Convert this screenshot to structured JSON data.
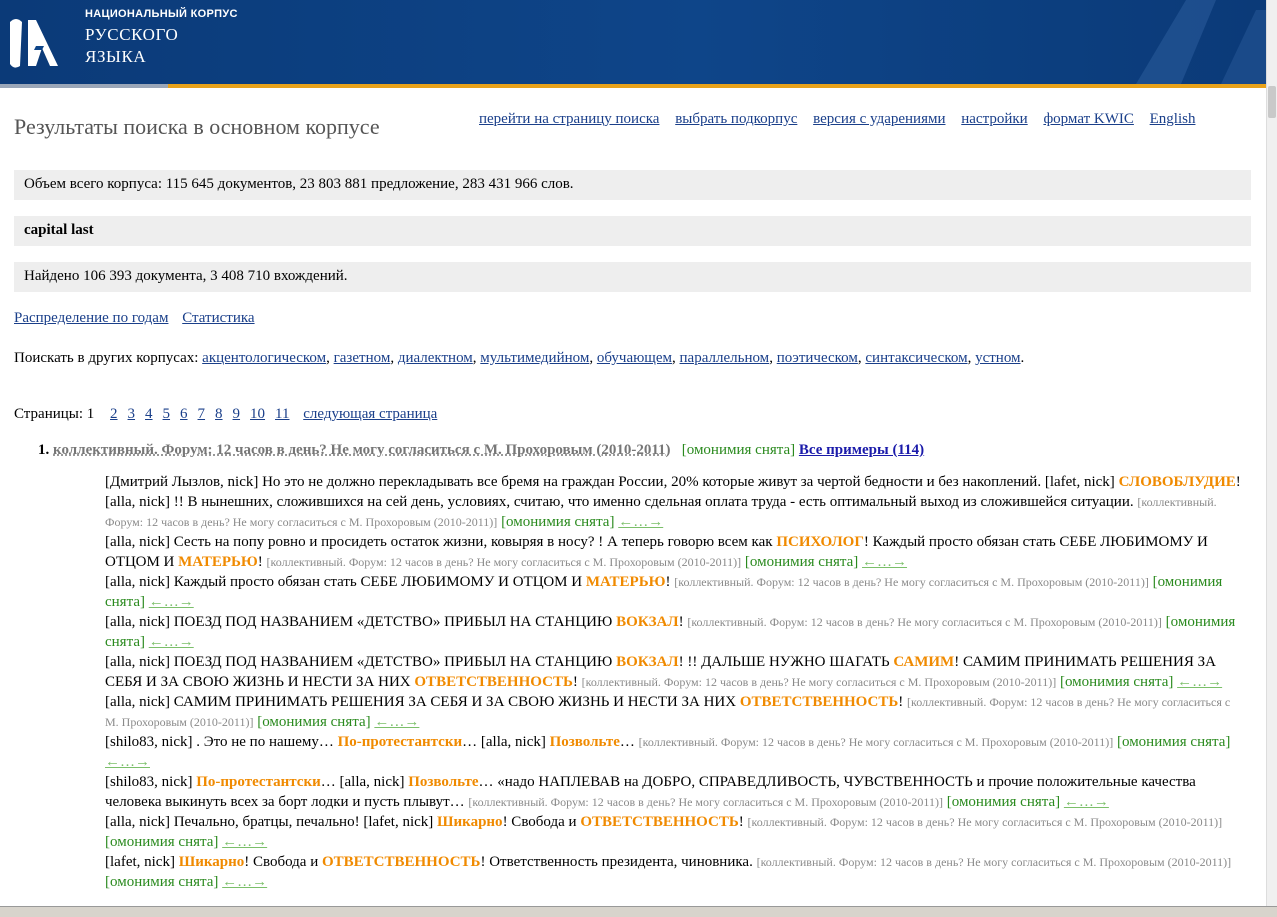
{
  "logo": {
    "line1": "НАЦИОНАЛЬНЫЙ КОРПУС",
    "line2": "РУССКОГО",
    "line3": "ЯЗЫКА"
  },
  "page_title": "Результаты поиска в основном корпусе",
  "top_links": [
    "перейти на страницу поиска",
    "выбрать подкорпус",
    "версия с ударениями",
    "настройки",
    "формат KWIC",
    "English"
  ],
  "corpus_size": "Объем всего корпуса: 115 645 документов, 23 803 881 предложение, 283 431 966 слов.",
  "query": "capital last",
  "found": "Найдено 106 393 документа, 3 408 710 вхождений.",
  "stat_links": [
    "Распределение по годам",
    "Статистика"
  ],
  "other_corpora": {
    "prefix": "Поискать в других корпусах:",
    "items": [
      "акцентологическом",
      "газетном",
      "диалектном",
      "мультимедийном",
      "обучающем",
      "параллельном",
      "поэтическом",
      "синтаксическом",
      "устном"
    ]
  },
  "pages": {
    "label": "Страницы:",
    "current": "1",
    "items": [
      "2",
      "3",
      "4",
      "5",
      "6",
      "7",
      "8",
      "9",
      "10",
      "11"
    ],
    "next": "следующая страница"
  },
  "result": {
    "number": "1.",
    "title": "коллективный. Форум: 12 часов в день? Не могу согласиться с М. Прохоровым (2010-2011)",
    "homonymy": "[омонимия снята]",
    "all_examples": "Все примеры (114)",
    "source": "[коллективный. Форум: 12 часов в день? Не могу согласиться с М. Прохоровым (2010-2011)]",
    "arrows": "←…→",
    "snippets": [
      [
        {
          "t": "[Дмитрий Лызлов, nick] Но это не должно перекладывать все бремя на граждан России, 20% которые живут за чертой бедности и без накоплений. [lafet, nick] "
        },
        {
          "h": "СЛОВОБЛУДИЕ"
        },
        {
          "t": "! [alla, nick] !! В нынешних, сложившихся на сей день, условиях, считаю, что именно сдельная оплата труда - есть оптимальный выход из сложившейся ситуации. "
        }
      ],
      [
        {
          "t": "[alla, nick] Сесть на попу ровно и просидеть остаток жизни, ковыряя в носу? ! А теперь говорю всем как "
        },
        {
          "h": "ПСИХОЛОГ"
        },
        {
          "t": "! Каждый просто обязан стать СЕБЕ ЛЮБИМОМУ И ОТЦОМ И "
        },
        {
          "h": "МАТЕРЬЮ"
        },
        {
          "t": "! "
        }
      ],
      [
        {
          "t": "[alla, nick] Каждый просто обязан стать СЕБЕ ЛЮБИМОМУ И ОТЦОМ И "
        },
        {
          "h": "МАТЕРЬЮ"
        },
        {
          "t": "! "
        }
      ],
      [
        {
          "t": "[alla, nick] ПОЕЗД ПОД НАЗВАНИЕМ «ДЕТСТВО» ПРИБЫЛ НА СТАНЦИЮ "
        },
        {
          "h": "ВОКЗАЛ"
        },
        {
          "t": "! "
        }
      ],
      [
        {
          "t": "[alla, nick] ПОЕЗД ПОД НАЗВАНИЕМ «ДЕТСТВО» ПРИБЫЛ НА СТАНЦИЮ "
        },
        {
          "h": "ВОКЗАЛ"
        },
        {
          "t": "! !! ДАЛЬШЕ НУЖНО ШАГАТЬ "
        },
        {
          "h": "САМИМ"
        },
        {
          "t": "! САМИМ ПРИНИМАТЬ РЕШЕНИЯ ЗА СЕБЯ И ЗА СВОЮ ЖИЗНЬ И НЕСТИ ЗА НИХ "
        },
        {
          "h": "ОТВЕТСТВЕННОСТЬ"
        },
        {
          "t": "! "
        }
      ],
      [
        {
          "t": "[alla, nick] САМИМ ПРИНИМАТЬ РЕШЕНИЯ ЗА СЕБЯ И ЗА СВОЮ ЖИЗНЬ И НЕСТИ ЗА НИХ "
        },
        {
          "h": "ОТВЕТСТВЕННОСТЬ"
        },
        {
          "t": "! "
        }
      ],
      [
        {
          "t": "[shilo83, nick] . Это не по нашему… "
        },
        {
          "h": "По-протестантски"
        },
        {
          "t": "… [alla, nick] "
        },
        {
          "h": "Позвольте"
        },
        {
          "t": "… "
        }
      ],
      [
        {
          "t": "[shilo83, nick] "
        },
        {
          "h": "По-протестантски"
        },
        {
          "t": "… [alla, nick] "
        },
        {
          "h": "Позвольте"
        },
        {
          "t": "… «надо НАПЛЕВАВ на ДОБРО, СПРАВЕДЛИВОСТЬ, ЧУВСТВЕННОСТЬ и прочие положительные качества человека выкинуть всех за борт лодки и пусть плывут… "
        }
      ],
      [
        {
          "t": "[alla, nick] Печально, братцы, печально! [lafet, nick] "
        },
        {
          "h": "Шикарно"
        },
        {
          "t": "! Свобода и "
        },
        {
          "h": "ОТВЕТСТВЕННОСТЬ"
        },
        {
          "t": "! "
        }
      ],
      [
        {
          "t": "[lafet, nick] "
        },
        {
          "h": "Шикарно"
        },
        {
          "t": "! Свобода и "
        },
        {
          "h": "ОТВЕТСТВЕННОСТЬ"
        },
        {
          "t": "! Ответственность президента, чиновника. "
        }
      ]
    ]
  }
}
